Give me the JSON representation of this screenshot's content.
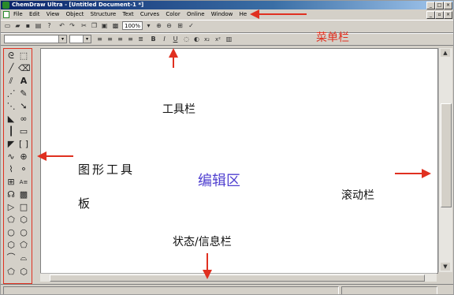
{
  "window": {
    "title": "ChemDraw Ultra - [Untitled Document-1 *]",
    "controls": [
      "_",
      "□",
      "×"
    ]
  },
  "menubar": {
    "items": [
      "File",
      "Edit",
      "View",
      "Object",
      "Structure",
      "Text",
      "Curves",
      "Color",
      "Online",
      "Window",
      "He"
    ]
  },
  "toolbar": {
    "zoom_value": "100%"
  },
  "annotations": {
    "menubar_label": "菜单栏",
    "toolbar_label": "工具栏",
    "palette_label_line1": "图形工具",
    "palette_label_line2": "板",
    "editor_label": "编辑区",
    "scrollbar_label": "滚动栏",
    "statusbar_label": "状态/信息栏"
  },
  "colors": {
    "annotation_arrow": "#e03020",
    "palette_outline": "#e03020",
    "editor_label": "#5040d0",
    "menubar_label": "#e03020"
  }
}
